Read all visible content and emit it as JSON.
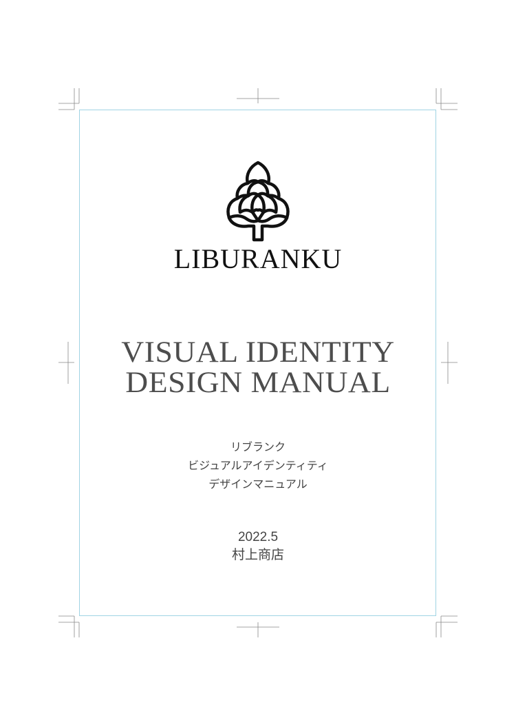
{
  "document": {
    "brand_name": "LIBURANKU",
    "title_lines": [
      "VISUAL IDENTITY",
      "DESIGN MANUAL"
    ],
    "subtitle_lines": [
      "リブランク",
      "ビジュアルアイデンティティ",
      "デザインマニュアル"
    ],
    "date": "2022.5",
    "company": "村上商店"
  },
  "logo": {
    "icon": "artichoke-emblem-icon"
  },
  "colors": {
    "trim_line": "#9fd3e3",
    "crop_marks": "#888888",
    "title_text": "#4d4d4d",
    "logo": "#111111"
  }
}
